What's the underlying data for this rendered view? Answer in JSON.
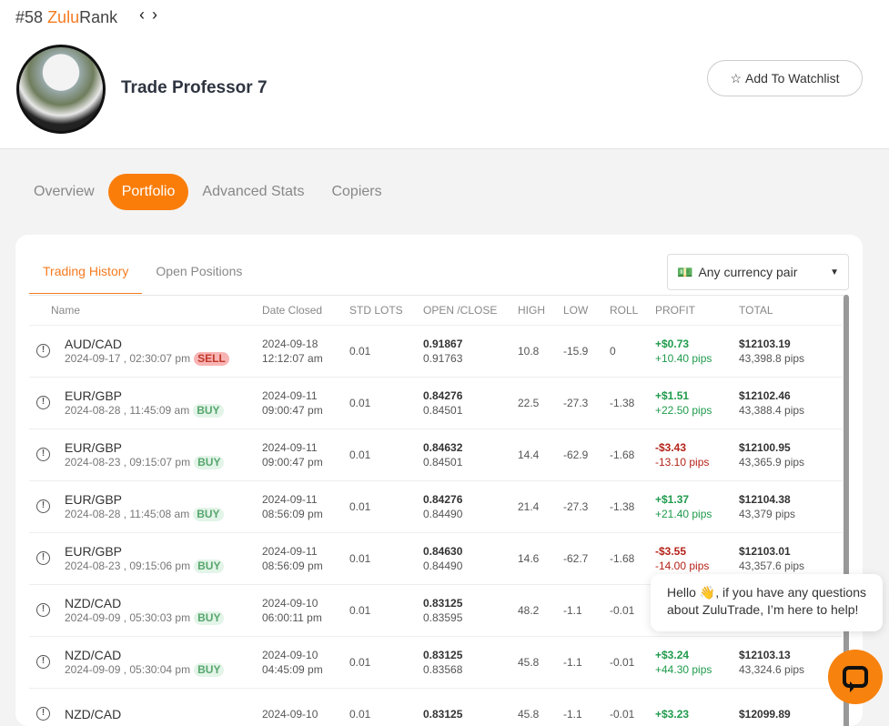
{
  "header": {
    "rank": "#58",
    "rank_brand_a": "Zulu",
    "rank_brand_b": "Rank",
    "prev": "‹",
    "next": "›",
    "trader_name": "Trade Professor 7",
    "watchlist_label": "Add To Watchlist"
  },
  "tabs": [
    "Overview",
    "Portfolio",
    "Advanced Stats",
    "Copiers"
  ],
  "subtabs": [
    "Trading History",
    "Open Positions"
  ],
  "currency_filter": "Any currency pair",
  "columns": [
    "Name",
    "Date Closed",
    "STD LOTS",
    "OPEN /CLOSE",
    "HIGH",
    "LOW",
    "ROLL",
    "PROFIT",
    "TOTAL"
  ],
  "rows": [
    {
      "pair": "AUD/CAD",
      "opened": "2024-09-17 , 02:30:07 pm",
      "side": "SELL",
      "closed_date": "2024-09-18",
      "closed_time": "12:12:07 am",
      "lots": "0.01",
      "open": "0.91867",
      "close": "0.91763",
      "high": "10.8",
      "low": "-15.9",
      "roll": "0",
      "profit": "+$0.73",
      "profit_pips": "+10.40 pips",
      "total": "$12103.19",
      "total_pips": "43,398.8 pips",
      "sign": "pos"
    },
    {
      "pair": "EUR/GBP",
      "opened": "2024-08-28 , 11:45:09 am",
      "side": "BUY",
      "closed_date": "2024-09-11",
      "closed_time": "09:00:47 pm",
      "lots": "0.01",
      "open": "0.84276",
      "close": "0.84501",
      "high": "22.5",
      "low": "-27.3",
      "roll": "-1.38",
      "profit": "+$1.51",
      "profit_pips": "+22.50 pips",
      "total": "$12102.46",
      "total_pips": "43,388.4 pips",
      "sign": "pos"
    },
    {
      "pair": "EUR/GBP",
      "opened": "2024-08-23 , 09:15:07 pm",
      "side": "BUY",
      "closed_date": "2024-09-11",
      "closed_time": "09:00:47 pm",
      "lots": "0.01",
      "open": "0.84632",
      "close": "0.84501",
      "high": "14.4",
      "low": "-62.9",
      "roll": "-1.68",
      "profit": "-$3.43",
      "profit_pips": "-13.10 pips",
      "total": "$12100.95",
      "total_pips": "43,365.9 pips",
      "sign": "neg"
    },
    {
      "pair": "EUR/GBP",
      "opened": "2024-08-28 , 11:45:08 am",
      "side": "BUY",
      "closed_date": "2024-09-11",
      "closed_time": "08:56:09 pm",
      "lots": "0.01",
      "open": "0.84276",
      "close": "0.84490",
      "high": "21.4",
      "low": "-27.3",
      "roll": "-1.38",
      "profit": "+$1.37",
      "profit_pips": "+21.40 pips",
      "total": "$12104.38",
      "total_pips": "43,379 pips",
      "sign": "pos"
    },
    {
      "pair": "EUR/GBP",
      "opened": "2024-08-23 , 09:15:06 pm",
      "side": "BUY",
      "closed_date": "2024-09-11",
      "closed_time": "08:56:09 pm",
      "lots": "0.01",
      "open": "0.84630",
      "close": "0.84490",
      "high": "14.6",
      "low": "-62.7",
      "roll": "-1.68",
      "profit": "-$3.55",
      "profit_pips": "-14.00 pips",
      "total": "$12103.01",
      "total_pips": "43,357.6 pips",
      "sign": "neg"
    },
    {
      "pair": "NZD/CAD",
      "opened": "2024-09-09 , 05:30:03 pm",
      "side": "BUY",
      "closed_date": "2024-09-10",
      "closed_time": "06:00:11 pm",
      "lots": "0.01",
      "open": "0.83125",
      "close": "0.83595",
      "high": "48.2",
      "low": "-1.1",
      "roll": "-0.01",
      "profit": "",
      "profit_pips": "",
      "total": "",
      "total_pips": "",
      "sign": "pos"
    },
    {
      "pair": "NZD/CAD",
      "opened": "2024-09-09 , 05:30:04 pm",
      "side": "BUY",
      "closed_date": "2024-09-10",
      "closed_time": "04:45:09 pm",
      "lots": "0.01",
      "open": "0.83125",
      "close": "0.83568",
      "high": "45.8",
      "low": "-1.1",
      "roll": "-0.01",
      "profit": "+$3.24",
      "profit_pips": "+44.30 pips",
      "total": "$12103.13",
      "total_pips": "43,324.6 pips",
      "sign": "pos"
    },
    {
      "pair": "NZD/CAD",
      "opened": "",
      "side": "",
      "closed_date": "2024-09-10",
      "closed_time": "",
      "lots": "0.01",
      "open": "0.83125",
      "close": "",
      "high": "45.8",
      "low": "-1.1",
      "roll": "-0.01",
      "profit": "+$3.23",
      "profit_pips": "",
      "total": "$12099.89",
      "total_pips": "",
      "sign": "pos"
    }
  ],
  "chat": {
    "message": "Hello 👋, if you have any questions about ZuluTrade, I’m here to help!"
  },
  "colors": {
    "accent": "#fa7d0a",
    "positive": "#1f9b4c",
    "negative": "#b42318"
  }
}
